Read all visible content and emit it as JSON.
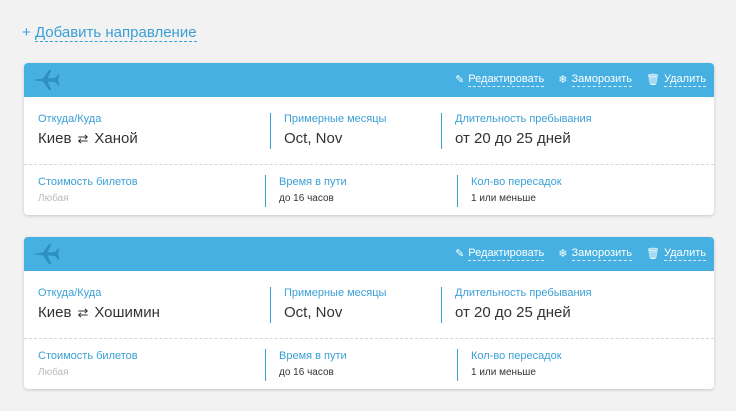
{
  "add_direction": {
    "icon": "+",
    "label": "Добавить направление"
  },
  "actions": {
    "edit": "Редактировать",
    "freeze": "Заморозить",
    "delete": "Удалить"
  },
  "cards": [
    {
      "from_label": "Откуда/Куда",
      "from": "Киев",
      "to": "Ханой",
      "months_label": "Примерные месяцы",
      "months": "Oct, Nov",
      "duration_label": "Длительность пребывания",
      "duration": "от 20 до 25 дней",
      "price_label": "Стоимость билетов",
      "price": "Любая",
      "travel_label": "Время в пути",
      "travel": "до 16 часов",
      "transfers_label": "Кол-во пересадок",
      "transfers": "1 или меньше"
    },
    {
      "from_label": "Откуда/Куда",
      "from": "Киев",
      "to": "Хошимин",
      "months_label": "Примерные месяцы",
      "months": "Oct, Nov",
      "duration_label": "Длительность пребывания",
      "duration": "от 20 до 25 дней",
      "price_label": "Стоимость билетов",
      "price": "Любая",
      "travel_label": "Время в пути",
      "travel": "до 16 часов",
      "transfers_label": "Кол-во пересадок",
      "transfers": "1 или меньше"
    }
  ]
}
